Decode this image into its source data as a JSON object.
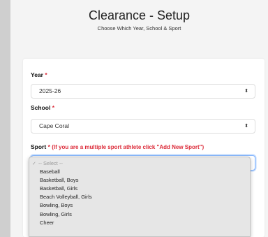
{
  "header": {
    "title": "Clearance - Setup",
    "subtitle": "Choose Which Year, School & Sport"
  },
  "form": {
    "required_mark": "*",
    "year": {
      "label": "Year",
      "value": "2025-26"
    },
    "school": {
      "label": "School",
      "value": "Cape Coral"
    },
    "sport": {
      "label": "Sport",
      "note": "(If you are a multiple sport athlete click \"Add New Sport\")"
    }
  },
  "dropdown": {
    "placeholder": "-- Select --",
    "options": [
      "Baseball",
      "Basketball, Boys",
      "Basketball, Girls",
      "Beach Volleyball, Girls",
      "Bowling, Boys",
      "Bowling, Girls",
      "Cheer"
    ]
  },
  "icons": {
    "chevron": "chevron-updown-icon",
    "check": "checkmark-icon"
  },
  "colors": {
    "required": "#dc2b39",
    "focus": "#86b7fe"
  }
}
